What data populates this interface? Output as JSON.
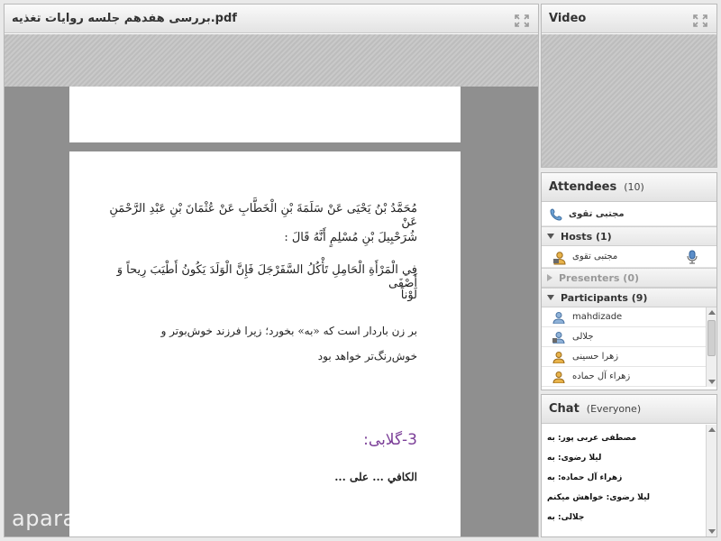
{
  "share": {
    "title": "بررسی هفدهم جلسه روایات تغذیه.pdf",
    "page": {
      "arabic_line1": "مُحَمَّدُ بْنُ يَحْيَى عَنْ سَلَمَةَ بْنِ الْخَطَّابِ عَنْ عُثْمَانَ بْنِ عَبْدِ الرَّحْمَنِ عَنْ",
      "arabic_line2": "شُرَحْبِيلَ بْنِ مُسْلِمٍ أَنَّهُ قَالَ :",
      "arabic_line3": "فِي الْمَرْأَةِ الْحَامِلِ تَأْكُلُ السَّفَرْجَلَ فَإِنَّ الْوَلَدَ يَكُونُ أَطْيَبَ رِيحاً وَ أَصْفَى",
      "arabic_line4": "لَوْناً",
      "persian_line1": "بر زن باردار است که «به» بخورد؛ زيرا فرزند خوش‌بوتر و",
      "persian_line2": "خوش‌رنگ‌تر خواهد بود",
      "heading": "3-گلابی:",
      "truncated_line": "الكافي ... على ..."
    },
    "watermark": "aparat.com/farhadpourkivan"
  },
  "video": {
    "title": "Video"
  },
  "attendees": {
    "title": "Attendees",
    "count": "(10)",
    "me_name": "مجتبی تقوی",
    "hosts_label": "Hosts (1)",
    "host_name": "مجتبی تقوی",
    "presenters_label": "Presenters (0)",
    "participants_label": "Participants (9)",
    "participants": [
      "mahdizade",
      "جلالی",
      "زهرا حسینی",
      "زهراء آل حماده"
    ]
  },
  "chat": {
    "title": "Chat",
    "scope": "(Everyone)",
    "messages": [
      "مصطفی عربی پور: به",
      "لیلا رضوی: به",
      "زهراء آل حماده: به",
      "لیلا رضوی: خواهش میکنم",
      "جلالی: به"
    ]
  },
  "colors": {
    "heading": "#7a3d97",
    "pod_border": "#b9b9b9",
    "doc_bg": "#8f8f8f"
  }
}
